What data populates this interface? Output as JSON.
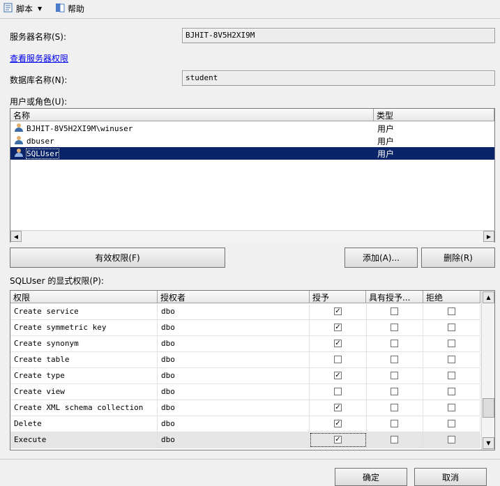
{
  "toolbar": {
    "script_label": "脚本",
    "help_label": "帮助"
  },
  "server": {
    "label": "服务器名称(S):",
    "value": "BJHIT-8V5H2XI9M",
    "view_permissions_link": "查看服务器权限"
  },
  "database": {
    "label": "数据库名称(N):",
    "value": "student"
  },
  "users": {
    "label": "用户或角色(U):",
    "columns": [
      "名称",
      "类型"
    ],
    "rows": [
      {
        "name": "BJHIT-8V5H2XI9M\\winuser",
        "type": "用户",
        "selected": false
      },
      {
        "name": "dbuser",
        "type": "用户",
        "selected": false
      },
      {
        "name": "SQLUser",
        "type": "用户",
        "selected": true
      }
    ]
  },
  "buttons": {
    "effective": "有效权限(F)",
    "add": "添加(A)...",
    "remove": "删除(R)",
    "ok": "确定",
    "cancel": "取消"
  },
  "permissions": {
    "label": "SQLUser 的显式权限(P):",
    "columns": [
      "权限",
      "授权者",
      "授予",
      "具有授予...",
      "拒绝"
    ],
    "rows": [
      {
        "permission": "Create service",
        "grantor": "dbo",
        "grant": true,
        "with_grant": false,
        "deny": false
      },
      {
        "permission": "Create symmetric key",
        "grantor": "dbo",
        "grant": true,
        "with_grant": false,
        "deny": false
      },
      {
        "permission": "Create synonym",
        "grantor": "dbo",
        "grant": true,
        "with_grant": false,
        "deny": false
      },
      {
        "permission": "Create table",
        "grantor": "dbo",
        "grant": false,
        "with_grant": false,
        "deny": false
      },
      {
        "permission": "Create type",
        "grantor": "dbo",
        "grant": true,
        "with_grant": false,
        "deny": false
      },
      {
        "permission": "Create view",
        "grantor": "dbo",
        "grant": false,
        "with_grant": false,
        "deny": false
      },
      {
        "permission": "Create XML schema collection",
        "grantor": "dbo",
        "grant": true,
        "with_grant": false,
        "deny": false
      },
      {
        "permission": "Delete",
        "grantor": "dbo",
        "grant": true,
        "with_grant": false,
        "deny": false
      },
      {
        "permission": "Execute",
        "grantor": "dbo",
        "grant": true,
        "with_grant": false,
        "deny": false,
        "selected": true
      }
    ]
  },
  "colors": {
    "selection": "#0a246a",
    "link": "#0000ee"
  }
}
